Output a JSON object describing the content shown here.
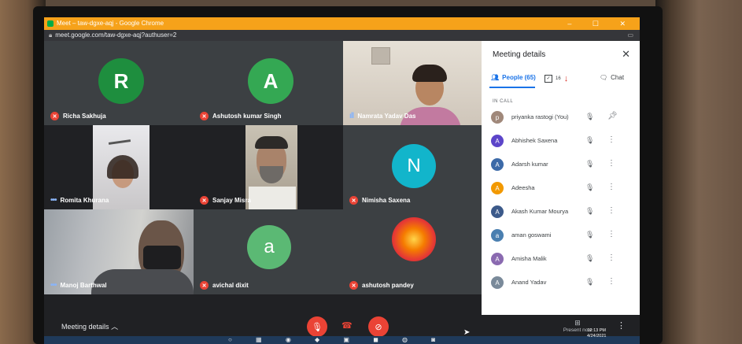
{
  "window": {
    "title": "Meet – taw-dgxe-aqj - Google Chrome",
    "controls": "– ☐ ✕",
    "url": "meet.google.com/taw-dgxe-aqj?authuser=2"
  },
  "tiles": [
    {
      "name": "Richa Sakhuja",
      "initial": "R",
      "avatar_color": "#1e8e3e",
      "mic": "off"
    },
    {
      "name": "Ashutosh kumar Singh",
      "initial": "A",
      "avatar_color": "#34a853",
      "mic": "off"
    },
    {
      "name": "Namrata Yadav Das",
      "mic": "speaking"
    },
    {
      "name": "Romita Khurana",
      "mic": "dots"
    },
    {
      "name": "Sanjay Misra",
      "mic": "off"
    },
    {
      "name": "Nimisha Saxena",
      "initial": "N",
      "avatar_color": "#12b5cb",
      "mic": "off"
    },
    {
      "name": "Manoj Barthwal",
      "mic": "dots"
    },
    {
      "name": "avichal dixit",
      "initial": "a",
      "avatar_color": "#5bb974",
      "mic": "off"
    },
    {
      "name": "ashutosh pandey",
      "mic": "off"
    }
  ],
  "panel": {
    "title": "Meeting details",
    "close_icon": "✕",
    "tabs": {
      "people": "People (65)",
      "activities_count": "16",
      "chat": "Chat"
    },
    "in_call_label": "IN CALL",
    "participants": [
      {
        "name": "priyanka rastogi (You)",
        "initial": "p",
        "color": "#a0887a"
      },
      {
        "name": "Abhishek Saxena",
        "initial": "A",
        "color": "#5c45c9"
      },
      {
        "name": "Adarsh kumar",
        "initial": "A",
        "color": "#3c6aa8"
      },
      {
        "name": "Adeesha",
        "initial": "A",
        "color": "#f29900"
      },
      {
        "name": "Akash Kumar Mourya",
        "initial": "A",
        "color": "#3c5a8a"
      },
      {
        "name": "aman goswami",
        "initial": "a",
        "color": "#4a7fb0"
      },
      {
        "name": "Amisha Malik",
        "initial": "A",
        "color": "#8a6ab0"
      },
      {
        "name": "Anand Yadav",
        "initial": "A",
        "color": "#7a8a9a"
      }
    ]
  },
  "bottom": {
    "meeting_details": "Meeting details",
    "present_now": "Present now"
  },
  "clock": {
    "time": "12:13 PM",
    "date": "4/24/2021"
  }
}
